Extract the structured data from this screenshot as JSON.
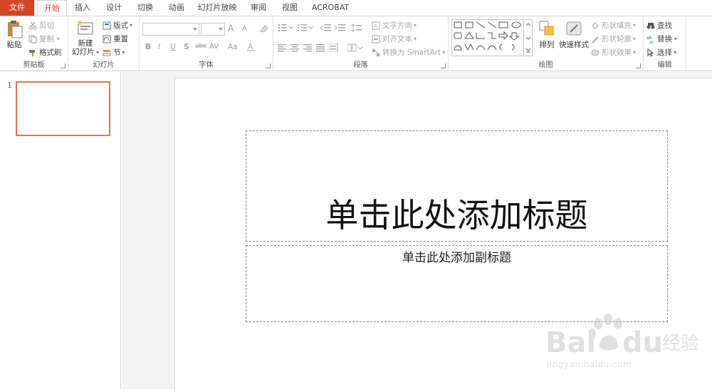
{
  "tabs": [
    "文件",
    "开始",
    "插入",
    "设计",
    "切换",
    "动画",
    "幻灯片放映",
    "审阅",
    "视图",
    "ACROBAT"
  ],
  "colors": {
    "accent": "#d24726",
    "thumb_border": "#e0735a"
  },
  "clipboard": {
    "paste": "粘贴",
    "cut": "剪切",
    "copy": "复制",
    "format_painter": "格式刷",
    "label": "剪贴板"
  },
  "slides": {
    "new_slide_line1": "新建",
    "new_slide_line2": "幻灯片",
    "layout": "版式",
    "reset": "重置",
    "section": "节",
    "label": "幻灯片"
  },
  "font": {
    "label": "字体",
    "bold": "B",
    "italic": "I",
    "underline": "U",
    "shadow": "S",
    "strikethrough": "abc",
    "spacing": "AV",
    "case": "Aa",
    "grow": "A",
    "shrink": "A"
  },
  "paragraph": {
    "text_direction": "文字方向",
    "align_text": "对齐文本",
    "smartart": "转换为 SmartArt",
    "label": "段落"
  },
  "drawing": {
    "arrange": "排列",
    "quick_styles": "快速样式",
    "shape_fill": "形状填充",
    "shape_outline": "形状轮廓",
    "shape_effects": "形状效果",
    "label": "绘图"
  },
  "editing": {
    "find": "查找",
    "replace": "替换",
    "select": "选择",
    "label": "编辑"
  },
  "thumbnail": {
    "number": "1"
  },
  "slide": {
    "title": "单击此处添加标题",
    "subtitle": "单击此处添加副标题"
  },
  "watermark": {
    "brand": "Bai du 经验",
    "url": "jingyan.baidu.com"
  }
}
